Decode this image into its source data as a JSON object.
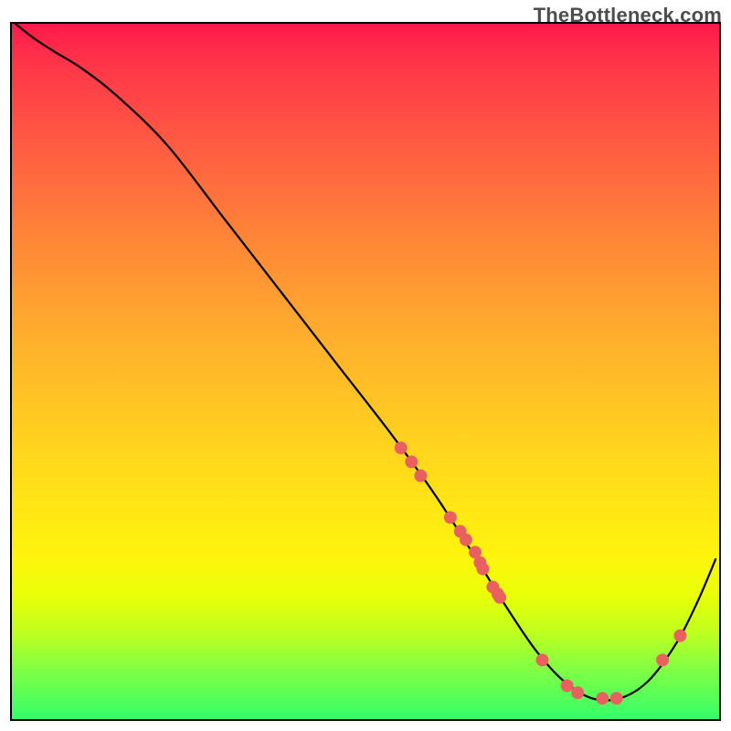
{
  "watermark": "TheBottleneck.com",
  "chart_data": {
    "type": "line",
    "title": "",
    "xlabel": "",
    "ylabel": "",
    "xlim": [
      0,
      100
    ],
    "ylim": [
      0,
      100
    ],
    "grid": false,
    "legend": false,
    "curve": {
      "name": "bottleneck-curve",
      "color": "#000000",
      "x": [
        0.5,
        3,
        6,
        10,
        15,
        22,
        30,
        38,
        46,
        54,
        60,
        66,
        70,
        74,
        78,
        82,
        86,
        90,
        94,
        97,
        99.5
      ],
      "y": [
        100,
        98,
        96,
        93.5,
        89.5,
        82.5,
        72,
        61.5,
        51,
        40.5,
        32,
        22.5,
        16,
        10,
        5.5,
        3,
        3,
        5.5,
        11,
        17,
        23
      ]
    },
    "markers": {
      "name": "data-points",
      "color": "#e86060",
      "radius_units": 0.9,
      "points": [
        {
          "x": 55,
          "y": 39
        },
        {
          "x": 56.5,
          "y": 37
        },
        {
          "x": 57.8,
          "y": 35
        },
        {
          "x": 62,
          "y": 29
        },
        {
          "x": 63.4,
          "y": 27
        },
        {
          "x": 64.2,
          "y": 25.8
        },
        {
          "x": 65.5,
          "y": 24
        },
        {
          "x": 66.2,
          "y": 22.5
        },
        {
          "x": 66.6,
          "y": 21.6
        },
        {
          "x": 68,
          "y": 19
        },
        {
          "x": 68.7,
          "y": 18
        },
        {
          "x": 69,
          "y": 17.5
        },
        {
          "x": 75,
          "y": 8.5
        },
        {
          "x": 78.5,
          "y": 4.8
        },
        {
          "x": 80,
          "y": 3.8
        },
        {
          "x": 83.5,
          "y": 3
        },
        {
          "x": 85.5,
          "y": 3
        },
        {
          "x": 92,
          "y": 8.5
        },
        {
          "x": 94.5,
          "y": 12
        }
      ]
    }
  }
}
